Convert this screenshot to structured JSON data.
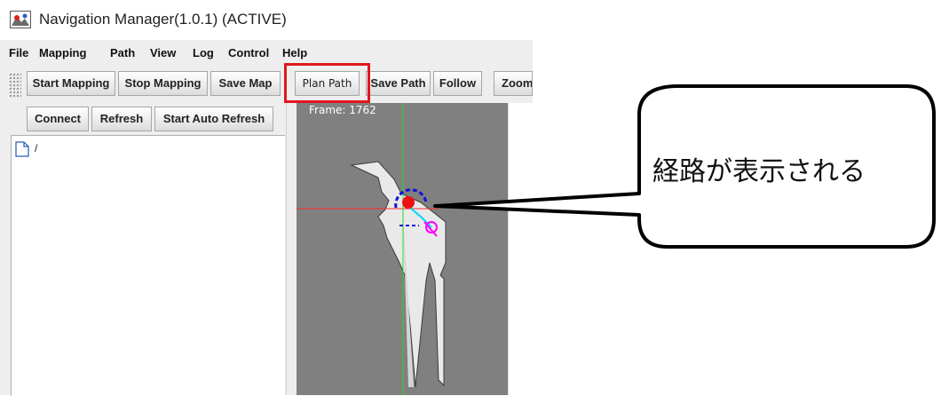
{
  "window": {
    "title": "Navigation Manager(1.0.1) (ACTIVE)"
  },
  "menu": [
    "File",
    "Mapping",
    "Path",
    "View",
    "Log",
    "Control",
    "Help"
  ],
  "toolbar": {
    "start_mapping": "Start Mapping",
    "stop_mapping": "Stop Mapping",
    "save_map": "Save Map",
    "plan_path": "Plan Path",
    "save_path": "Save Path",
    "follow": "Follow",
    "zoom_in": "Zoom In"
  },
  "left_panel": {
    "connect": "Connect",
    "refresh": "Refresh",
    "start_auto_refresh": "Start Auto Refresh",
    "tree_root": "/"
  },
  "map": {
    "frame_label": "Frame: 1762"
  },
  "callout": {
    "text": "経路が表示される"
  },
  "colors": {
    "highlight": "#e0181e",
    "map_bg": "#808080",
    "path": "#ff00ff",
    "robot": "#ff0000"
  },
  "icons": [
    "app-icon",
    "file-icon",
    "toolbar-grip"
  ]
}
